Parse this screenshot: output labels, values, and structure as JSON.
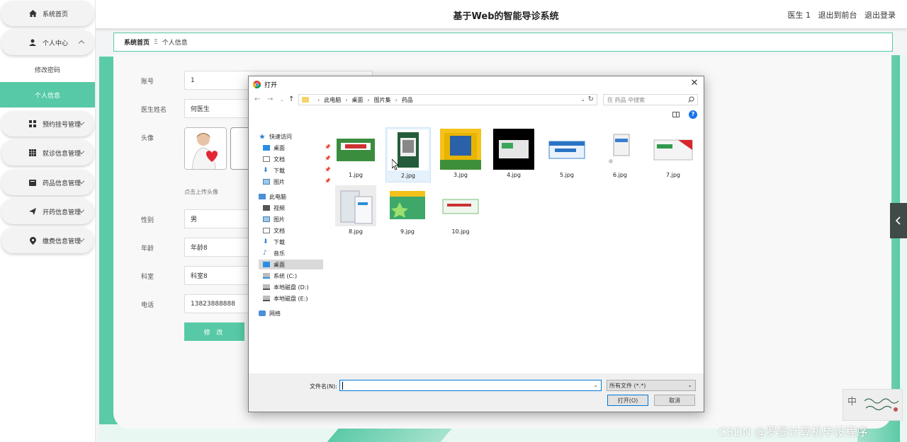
{
  "header": {
    "title": "基于Web的智能导诊系统",
    "user_label": "医生 1",
    "back_to_front": "退出到前台",
    "logout": "退出登录"
  },
  "sidebar": {
    "home": "系统首页",
    "personal_center": "个人中心",
    "submenu": [
      "修改密码",
      "个人信息"
    ],
    "items": [
      "预约挂号管理",
      "就诊信息管理",
      "药品信息管理",
      "开药信息管理",
      "缴费信息管理"
    ],
    "icons": [
      "home-icon",
      "user-icon",
      "grid-icon",
      "grid-icon",
      "box-icon",
      "send-icon",
      "pin-icon"
    ]
  },
  "breadcrumb": {
    "home": "系统首页",
    "separator": "Ξ",
    "current": "个人信息"
  },
  "form": {
    "account_label": "账号",
    "account_value": "1",
    "name_label": "医生姓名",
    "name_value": "何医生",
    "avatar_label": "头像",
    "upload_hint": "点击上传头像",
    "gender_label": "性别",
    "gender_value": "男",
    "age_label": "年龄",
    "age_value": "年龄8",
    "dept_label": "科室",
    "dept_value": "科室8",
    "phone_label": "电话",
    "phone_value": "13823888888",
    "submit": "修 改"
  },
  "dialog": {
    "title": "打开",
    "address": [
      "此电脑",
      "桌面",
      "图片集",
      "药品"
    ],
    "search_placeholder": "在 药品 中搜索",
    "tree": {
      "quick_access": "快速访问",
      "quick_items": [
        "桌面",
        "文档",
        "下载",
        "图片"
      ],
      "this_pc": "此电脑",
      "pc_items": [
        "视频",
        "图片",
        "文档",
        "下载",
        "音乐",
        "桌面",
        "系统 (C:)",
        "本地磁盘 (D:)",
        "本地磁盘 (E:)"
      ],
      "network": "网络"
    },
    "files": [
      "1.jpg",
      "2.jpg",
      "3.jpg",
      "4.jpg",
      "5.jpg",
      "6.jpg",
      "7.jpg",
      "8.jpg",
      "9.jpg",
      "10.jpg"
    ],
    "filename_label": "文件名(N):",
    "filename_value": "",
    "filetype": "所有文件 (*.*)",
    "open_button": "打开(O)",
    "cancel_button": "取消"
  },
  "watermark": "CSDN @罗曼计算机毕设程序",
  "ime_char": "中",
  "colors": {
    "accent": "#57c9a6",
    "dialog_selection": "#d9d9d9",
    "dialog_focus": "#0078d7"
  }
}
